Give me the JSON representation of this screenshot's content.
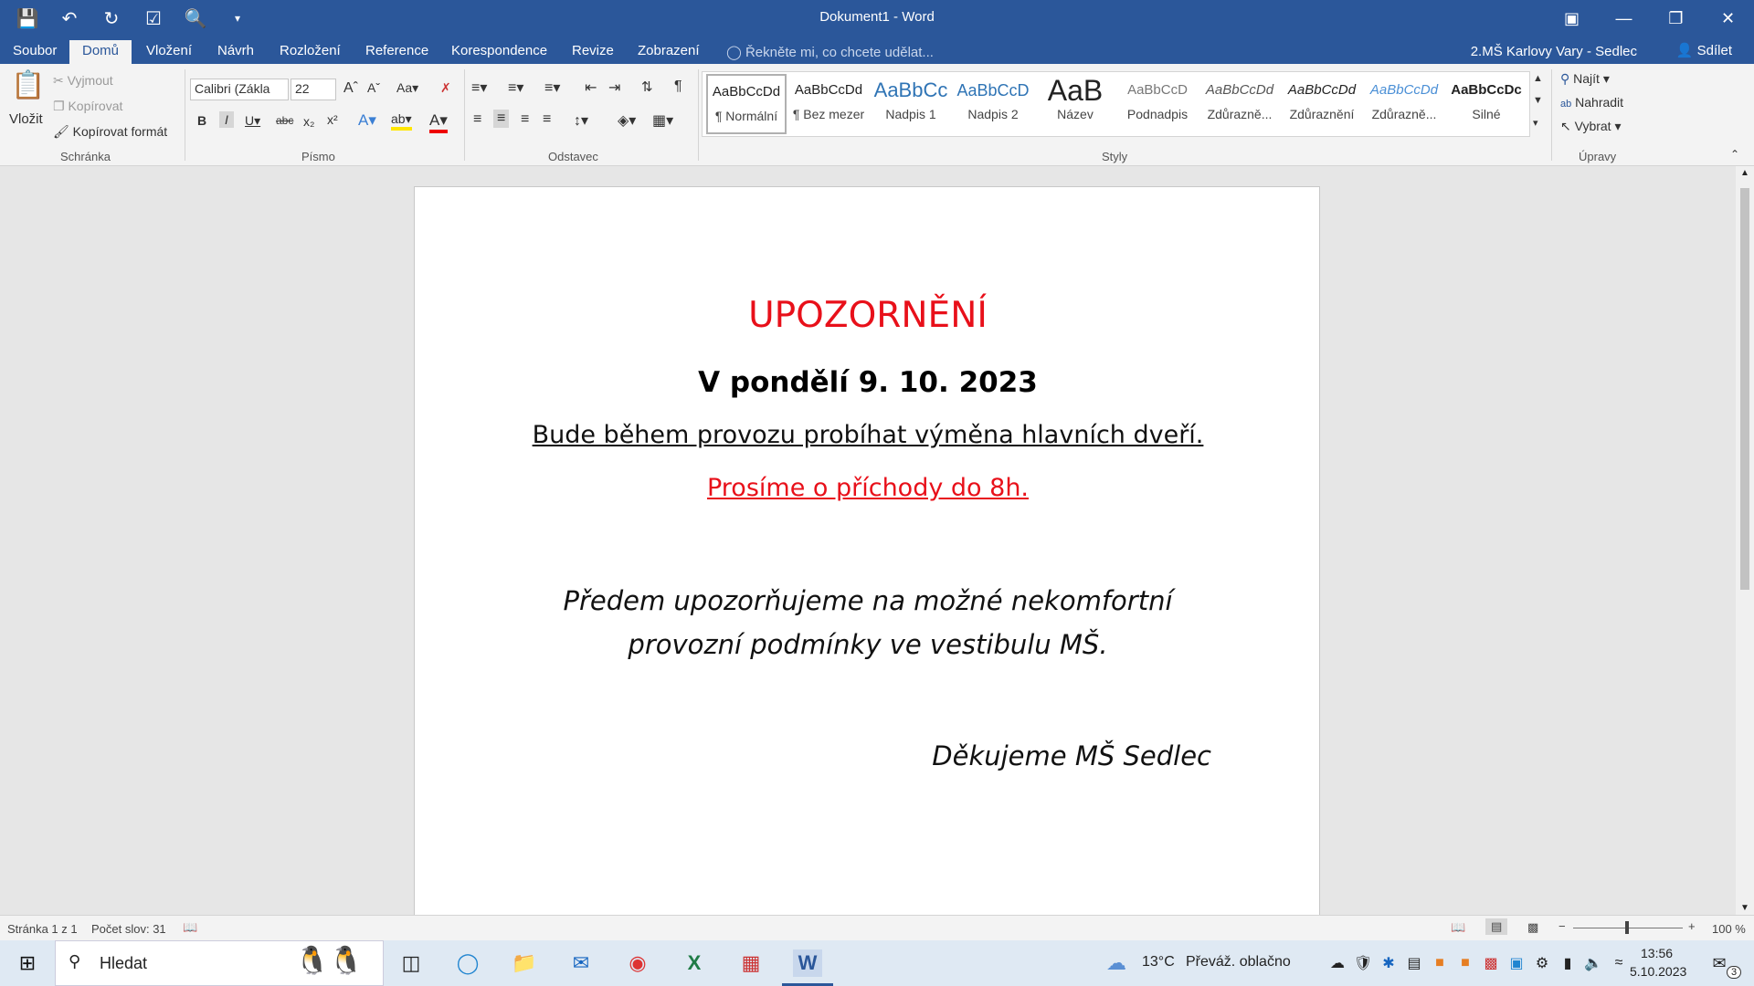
{
  "window": {
    "title": "Dokument1 - Word"
  },
  "tabs": [
    {
      "label": "Soubor"
    },
    {
      "label": "Domů"
    },
    {
      "label": "Vložení"
    },
    {
      "label": "Návrh"
    },
    {
      "label": "Rozložení"
    },
    {
      "label": "Reference"
    },
    {
      "label": "Korespondence"
    },
    {
      "label": "Revize"
    },
    {
      "label": "Zobrazení"
    }
  ],
  "tell_me": "Řekněte mi, co chcete udělat...",
  "user": "2.MŠ Karlovy Vary - Sedlec",
  "share": "Sdílet",
  "clipboard": {
    "paste": "Vložit",
    "cut": "Vyjmout",
    "copy": "Kopírovat",
    "format_painter": "Kopírovat formát",
    "label": "Schránka"
  },
  "font": {
    "name": "Calibri (Zákla",
    "size": "22",
    "label": "Písmo"
  },
  "paragraph": {
    "label": "Odstavec"
  },
  "styles": {
    "label": "Styly",
    "items": [
      {
        "preview": "AaBbCcDd",
        "name": "¶ Normální"
      },
      {
        "preview": "AaBbCcDd",
        "name": "¶ Bez mezer"
      },
      {
        "preview": "AaBbCc",
        "name": "Nadpis 1"
      },
      {
        "preview": "AaBbCcD",
        "name": "Nadpis 2"
      },
      {
        "preview": "AaB",
        "name": "Název"
      },
      {
        "preview": "AaBbCcD",
        "name": "Podnadpis"
      },
      {
        "preview": "AaBbCcDd",
        "name": "Zdůrazně..."
      },
      {
        "preview": "AaBbCcDd",
        "name": "Zdůraznění"
      },
      {
        "preview": "AaBbCcDd",
        "name": "Zdůrazně..."
      },
      {
        "preview": "AaBbCcDc",
        "name": "Silné"
      }
    ]
  },
  "editing": {
    "find": "Najít",
    "replace": "Nahradit",
    "select": "Vybrat",
    "label": "Úpravy"
  },
  "document": {
    "heading": "UPOZORNĚNÍ",
    "date_line": "V pondělí 9. 10. 2023",
    "line1": " Bude během provozu probíhat výměna hlavních dveří.",
    "line2": "Prosíme o příchody do 8h.",
    "line3a": "Předem upozorňujeme  na možné nekomfortní",
    "line3b": "provozní podmínky ve vestibulu MŠ.",
    "thanks": "Děkujeme MŠ Sedlec"
  },
  "status": {
    "page": "Stránka 1 z 1",
    "words": "Počet slov: 31",
    "zoom": "100 %"
  },
  "taskbar": {
    "search": "Hledat",
    "weather_temp": "13°C",
    "weather_text": "Převáž. oblačno",
    "time": "13:56",
    "date": "5.10.2023",
    "notif_count": "3"
  },
  "colors": {
    "accent": "#2b579a",
    "red_text": "#e8101a"
  }
}
